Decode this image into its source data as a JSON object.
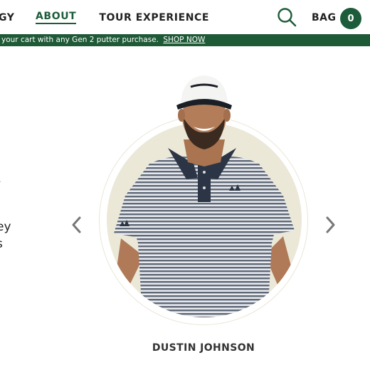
{
  "nav": {
    "items": [
      {
        "label": "TECHNOLOGY",
        "visible": "GY"
      },
      {
        "label": "ABOUT",
        "active": true
      },
      {
        "label": "TOUR EXPERIENCE"
      }
    ]
  },
  "header": {
    "bag_label": "BAG",
    "bag_count": "0"
  },
  "promo": {
    "text": "your cart with any Gen 2 putter purchase.",
    "link": "SHOP NOW"
  },
  "left_text": {
    "line1": "ey",
    "line2": "s"
  },
  "carousel": {
    "player_name": "DUSTIN JOHNSON",
    "prev_icon": "chevron-left-icon",
    "next_icon": "chevron-right-icon"
  },
  "colors": {
    "brand_green": "#1d5c3a",
    "promo_green": "#1f5a37",
    "portrait_bg": "#ebe8d8"
  }
}
